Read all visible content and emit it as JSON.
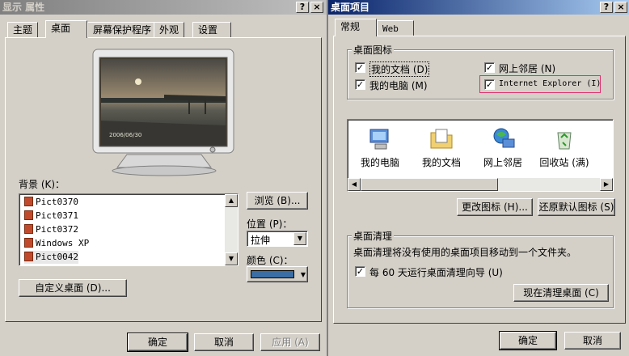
{
  "left_window": {
    "title": "显示 属性",
    "help_btn": "?",
    "close_btn": "×",
    "tabs": [
      "主题",
      "桌面",
      "屏幕保护程序",
      "外观",
      "设置"
    ],
    "preview_date": "2006/06/30",
    "background_label": "背景 (K)：",
    "background_items": [
      "Pict0370",
      "Pict0371",
      "Pict0372",
      "Windows XP",
      "Pict0042"
    ],
    "browse_btn": "浏览 (B)...",
    "position_label": "位置 (P)：",
    "position_value": "拉伸",
    "color_label": "颜色 (C)：",
    "color_value": "#3a6ea5",
    "customize_btn": "自定义桌面 (D)...",
    "ok_btn": "确定",
    "cancel_btn": "取消",
    "apply_btn": "应用 (A)"
  },
  "right_window": {
    "title": "桌面项目",
    "help_btn": "?",
    "close_btn": "×",
    "tabs": [
      "常规",
      "Web"
    ],
    "icons_group": "桌面图标",
    "checkboxes": [
      {
        "label": "我的文档 (D)",
        "checked": true
      },
      {
        "label": "网上邻居 (N)",
        "checked": true
      },
      {
        "label": "我的电脑 (M)",
        "checked": true
      },
      {
        "label": "Internet Explorer (I)",
        "checked": true
      }
    ],
    "desktop_icons": [
      "我的电脑",
      "我的文档",
      "网上邻居",
      "回收站 (满)",
      "回收"
    ],
    "change_icon_btn": "更改图标 (H)...",
    "restore_icon_btn": "还原默认图标 (S)",
    "cleanup_group": "桌面清理",
    "cleanup_desc": "桌面清理将没有使用的桌面项目移动到一个文件夹。",
    "cleanup_check": "每 60 天运行桌面清理向导 (U)",
    "cleanup_now_btn": "现在清理桌面 (C)",
    "ok_btn": "确定",
    "cancel_btn": "取消"
  }
}
